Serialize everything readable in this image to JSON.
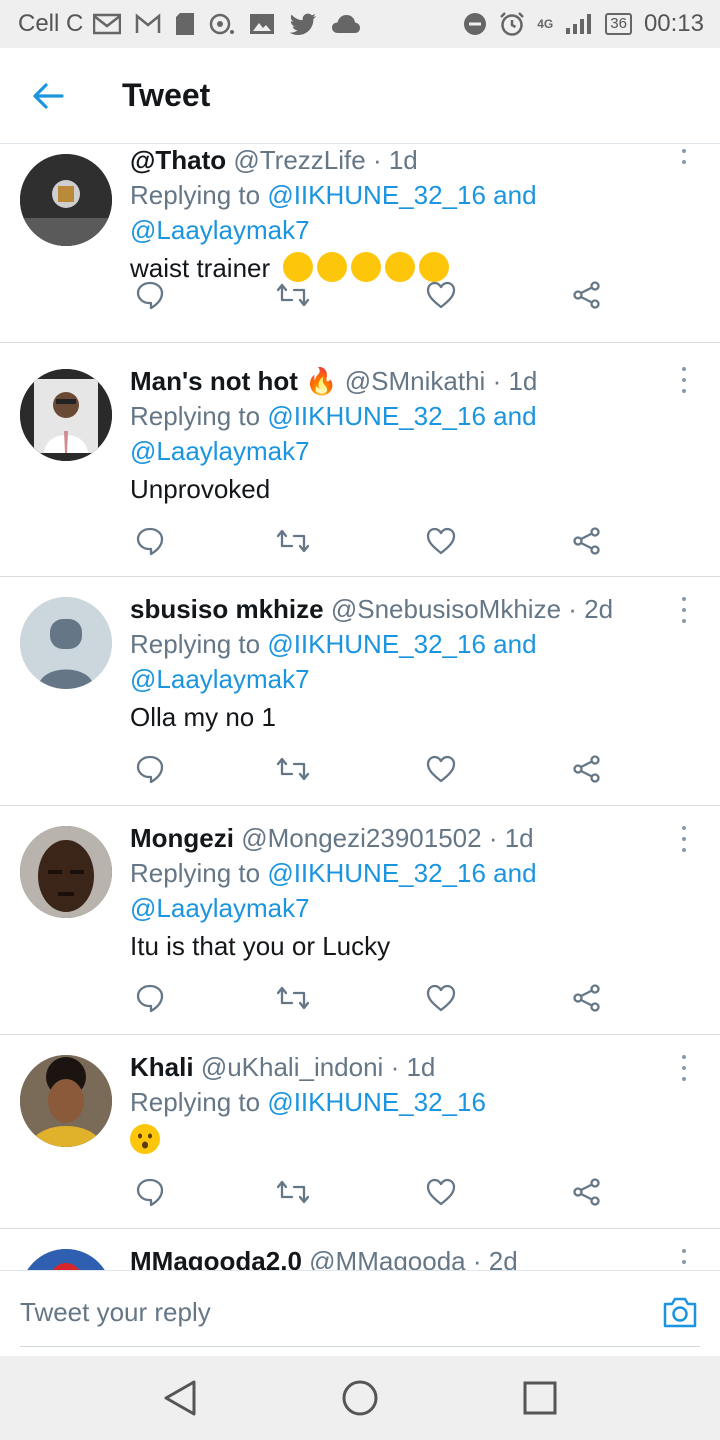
{
  "status_bar": {
    "carrier": "Cell C",
    "network": "4G",
    "battery": "36",
    "time": "00:13"
  },
  "app_bar": {
    "title": "Tweet"
  },
  "tweets": [
    {
      "name": "@Thato",
      "handle": "@TrezzLife",
      "time": "· 1d",
      "replying_prefix": "Replying to ",
      "replying_to": "@IIKHUNE_32_16 and @Laaylaymak7",
      "text": "waist trainer",
      "emojis": [
        "rofl",
        "rofl",
        "rofl",
        "rofl",
        "rofl"
      ]
    },
    {
      "name": "Man's not hot",
      "name_emoji": "🔥",
      "handle": "@SMnikathi",
      "time": "· 1d",
      "replying_prefix": "Replying to ",
      "replying_to": "@IIKHUNE_32_16 and @Laaylaymak7",
      "text": "Unprovoked"
    },
    {
      "name": "sbusiso mkhize",
      "handle": "@SnebusisoMkhize",
      "time": "· 2d",
      "replying_prefix": "Replying to ",
      "replying_to": "@IIKHUNE_32_16 and @Laaylaymak7",
      "text": "Olla my no 1"
    },
    {
      "name": "Mongezi",
      "handle": "@Mongezi23901502",
      "time": "· 1d",
      "replying_prefix": "Replying to ",
      "replying_to": "@IIKHUNE_32_16 and @Laaylaymak7",
      "text": "Itu is that you or Lucky"
    },
    {
      "name": "Khali",
      "handle": "@uKhali_indoni",
      "time": "· 1d",
      "replying_prefix": "Replying to ",
      "replying_to": "@IIKHUNE_32_16",
      "text": "",
      "emojis": [
        "hushed-face"
      ]
    },
    {
      "name": "MMagooda2.0",
      "handle": "@MMagooda",
      "time": "· 2d"
    }
  ],
  "reply_bar": {
    "placeholder": "Tweet your reply"
  },
  "colors": {
    "accent": "#1b95e0",
    "text": "#14171a",
    "muted": "#657786",
    "divider": "#dcdcdc"
  },
  "icons": [
    "back-arrow-icon",
    "reply-icon",
    "retweet-icon",
    "like-icon",
    "share-icon",
    "more-icon",
    "camera-icon",
    "nav-back-icon",
    "nav-home-icon",
    "nav-recents-icon"
  ]
}
